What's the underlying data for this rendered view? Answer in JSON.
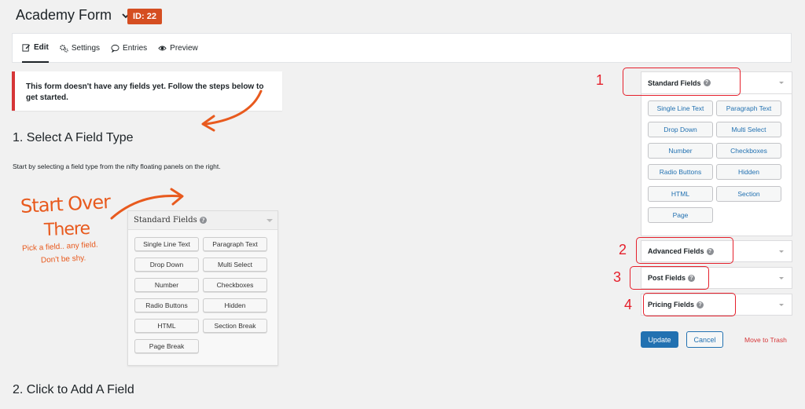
{
  "header": {
    "title": "Academy Form",
    "id_badge": "ID: 22"
  },
  "toolbar": {
    "items": [
      {
        "label": "Edit",
        "icon": "pencil-icon"
      },
      {
        "label": "Settings",
        "icon": "gears-icon"
      },
      {
        "label": "Entries",
        "icon": "speech-bubble-icon"
      },
      {
        "label": "Preview",
        "icon": "eye-icon"
      }
    ]
  },
  "notice": {
    "text": "This form doesn't have any fields yet. Follow the steps below to get started."
  },
  "steps": {
    "step1_title": "1. Select A Field Type",
    "step1_desc": "Start by selecting a field type from the nifty floating panels on the right.",
    "step2_title": "2. Click to Add A Field"
  },
  "illustration": {
    "hand_line1": "Start Over",
    "hand_line2": "There",
    "hand_line3": "Pick a field.. any field.",
    "hand_line4": "Don't be shy.",
    "panel_title": "Standard Fields",
    "buttons": [
      "Single Line Text",
      "Paragraph Text",
      "Drop Down",
      "Multi Select",
      "Number",
      "Checkboxes",
      "Radio Buttons",
      "Hidden",
      "HTML",
      "Section Break",
      "Page Break"
    ]
  },
  "sidebar": {
    "standard": {
      "title": "Standard Fields",
      "buttons": [
        "Single Line Text",
        "Paragraph Text",
        "Drop Down",
        "Multi Select",
        "Number",
        "Checkboxes",
        "Radio Buttons",
        "Hidden",
        "HTML",
        "Section",
        "Page"
      ]
    },
    "advanced": {
      "title": "Advanced Fields"
    },
    "post": {
      "title": "Post Fields"
    },
    "pricing": {
      "title": "Pricing Fields"
    }
  },
  "annotations": [
    "1",
    "2",
    "3",
    "4"
  ],
  "actions": {
    "update": "Update",
    "cancel": "Cancel",
    "trash": "Move to Trash"
  },
  "colors": {
    "accent": "#2271b1",
    "badge": "#d54e21",
    "annotation_red": "#e5202c",
    "handwriting": "#e85a1e"
  }
}
